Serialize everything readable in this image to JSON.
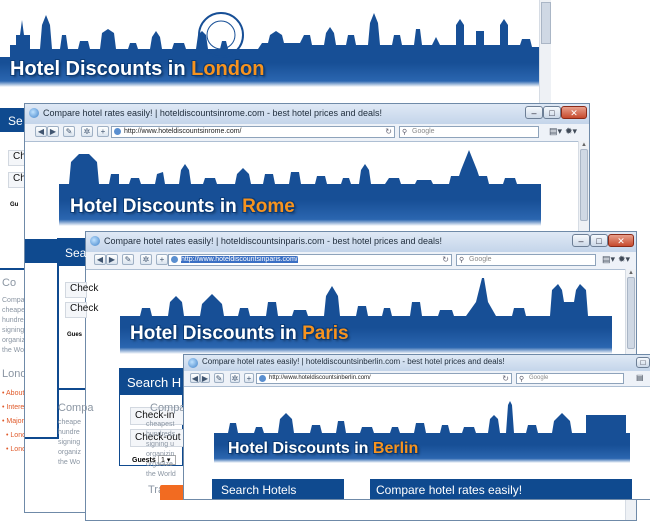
{
  "background_page": {
    "banner_title_a": "Hotel Discounts in ",
    "banner_title_city": "London",
    "search_head": "Se",
    "form": [
      "Ch",
      "Ch"
    ],
    "guests": "Gu",
    "side_text_1": "Co",
    "side_lines_1": [
      "Compa",
      "cheape",
      "hundre",
      "signing",
      "organiz",
      "hese t",
      "the Wo"
    ],
    "side_text_2": "Lond",
    "side_links": [
      "About",
      "Intere",
      "Major",
      "Lond",
      "Lond"
    ]
  },
  "windows": [
    {
      "title": "Compare hotel rates easily! | hoteldiscountsinrome.com - best hotel prices and deals!",
      "url": "http://www.hoteldiscountsinrome.com/",
      "url_selected": false,
      "search_placeholder": "Google",
      "banner_title_a": "Hotel Discounts in ",
      "banner_title_city": "Rome",
      "search_head": "Se",
      "form": [
        "Ch",
        "Ch"
      ],
      "guests": "Gu"
    },
    {
      "title": "Compare hotel rates easily! | hoteldiscountsinparis.com - best hotel prices and deals!",
      "url": "http://www.hoteldiscountsinparis.com/",
      "url_selected": true,
      "search_placeholder": "Google",
      "banner_title_a": "Hotel Discounts in ",
      "banner_title_city": "Paris",
      "search_head": "Sea",
      "form": [
        "Check",
        "Check"
      ],
      "guests": "Gues",
      "side_lines": [
        "Compa",
        "cheape",
        "hundre",
        "signing",
        "organiz",
        "hese t",
        "the Wo"
      ],
      "side_head": "Compa"
    },
    {
      "title": "Compare hotel rates easily! | hoteldiscountsinberlin.com - best hotel prices and deals!",
      "url": "http://www.hoteldiscountsinberlin.com/",
      "url_selected": false,
      "search_placeholder": "Google",
      "banner_title_a": "Hotel Discounts in ",
      "banner_title_city": "Berlin",
      "search_head": "Search Hotels",
      "compare_head": "Compare hotel rates easily!"
    }
  ],
  "paris_left": {
    "search_head": "Search H",
    "checkin": "Check-in",
    "checkout": "Check-out",
    "guests": "Guests",
    "guests_value": "1",
    "side_head": "Compa",
    "side_lines": [
      "cheapest",
      "hundreds",
      "signing u",
      "organizin",
      "organize",
      "the World"
    ],
    "travel": "Travel"
  },
  "icons": {
    "favicon": "globe-icon",
    "back": "back-arrow-icon",
    "forward": "forward-arrow-icon",
    "reload": "reload-icon",
    "page_menu": "page-icon",
    "tools": "gear-icon"
  },
  "colors": {
    "skyline": "#174f96",
    "title_orange": "#f7931e",
    "panel_blue": "#0f4a8f"
  }
}
